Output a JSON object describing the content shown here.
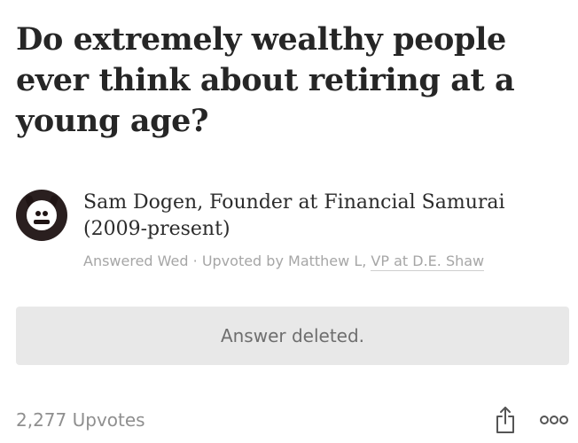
{
  "question": {
    "title": "Do extremely wealthy people ever think about retiring at a young age?"
  },
  "author": {
    "credential": "Sam Dogen, Founder at Financial Samurai (2009-present)",
    "avatar_icon": "samurai-mask-avatar"
  },
  "meta": {
    "answered": "Answered Wed",
    "separator": " · ",
    "upvoted_by": "Upvoted by Matthew L, ",
    "upvoter_credential": "VP at D.E. Shaw"
  },
  "answer": {
    "status": "Answer deleted."
  },
  "footer": {
    "upvotes": "2,277 Upvotes",
    "share_icon": "share-icon",
    "more_icon": "more-options-icon"
  },
  "colors": {
    "title": "#262626",
    "meta": "#a6a6a6",
    "deleted_bg": "#e8e8e8",
    "icon": "#555555"
  }
}
